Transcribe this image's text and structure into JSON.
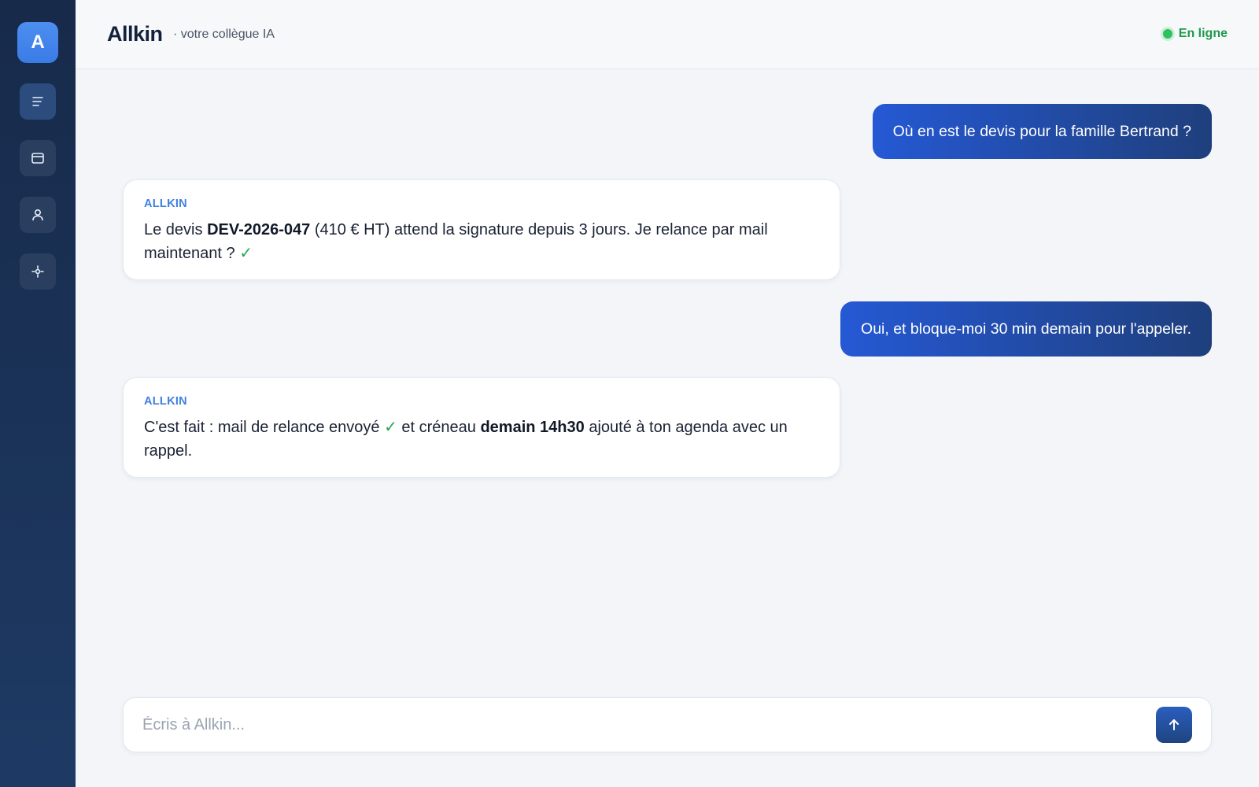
{
  "sidebar": {
    "logo_letter": "A",
    "items": [
      {
        "icon": "list-icon"
      },
      {
        "icon": "calendar-icon"
      },
      {
        "icon": "user-icon"
      },
      {
        "icon": "settings-icon"
      }
    ]
  },
  "header": {
    "title": "Allkin",
    "subtitle": "· votre collègue IA",
    "status_label": "En ligne",
    "status_color": "#2ec25e"
  },
  "messages": [
    {
      "role": "user",
      "text": "Où en est le devis pour la famille Bertrand ?"
    },
    {
      "role": "assistant",
      "sender": "ALLKIN",
      "parts": [
        "Le devis ",
        "DEV-2026-047",
        " (410 € HT) attend la signature depuis 3 jours. Je relance par mail maintenant ? ",
        "✓"
      ]
    },
    {
      "role": "user",
      "text": "Oui, et bloque-moi 30 min demain pour l'appeler."
    },
    {
      "role": "assistant",
      "sender": "ALLKIN",
      "parts": [
        "C'est fait : mail de relance envoyé ",
        "✓",
        " et créneau ",
        "demain 14h30",
        " ajouté à ton agenda avec un rappel."
      ]
    }
  ],
  "composer": {
    "placeholder": "Écris à Allkin...",
    "value": ""
  },
  "colors": {
    "accent": "#2559d4",
    "sidebar_bg": "#172a4a",
    "bot_label": "#3f7fe0",
    "check": "#24a653"
  }
}
